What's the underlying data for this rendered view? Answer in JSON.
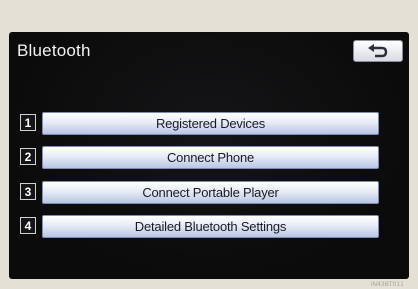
{
  "header": {
    "title": "Bluetooth",
    "back_icon": "return-arrow-icon"
  },
  "menu": {
    "items": [
      {
        "number": "1",
        "label": "Registered Devices"
      },
      {
        "number": "2",
        "label": "Connect Phone"
      },
      {
        "number": "3",
        "label": "Connect Portable Player"
      },
      {
        "number": "4",
        "label": "Detailed Bluetooth Settings"
      }
    ]
  },
  "colors": {
    "screen_background": "#0b0b0b",
    "button_gradient_top": "#ffffff",
    "button_gradient_bottom": "#b9c6e3",
    "title_text": "#f2f2f2",
    "bezel": "#e4e0d6"
  },
  "footer": {
    "code": "IN43BT011"
  }
}
